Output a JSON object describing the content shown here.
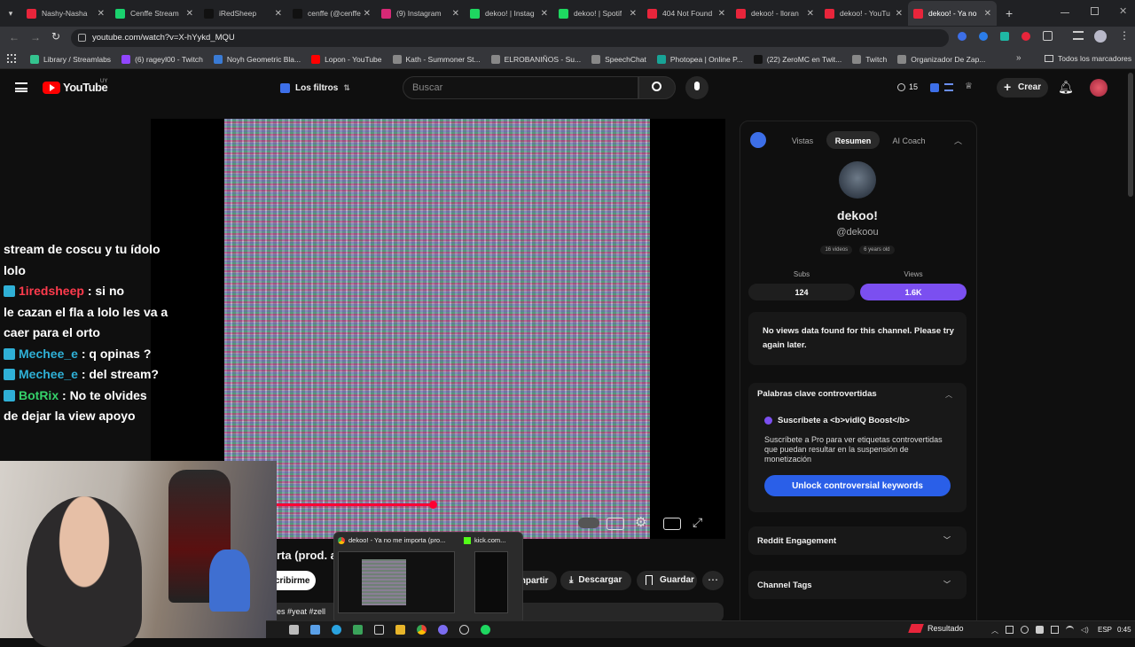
{
  "tabs": [
    {
      "label": "Nashy-Nasha",
      "color": "#e8253b"
    },
    {
      "label": "Cenffe Stream",
      "color": "#1ad16e"
    },
    {
      "label": "iRedSheep",
      "color": "#111111"
    },
    {
      "label": "cenffe (@cenffe",
      "color": "#111111"
    },
    {
      "label": "(9) Instagram",
      "color": "#d62976"
    },
    {
      "label": "dekoo! | Instag",
      "color": "#1ed760"
    },
    {
      "label": "dekoo! | Spotif",
      "color": "#1ed760"
    },
    {
      "label": "404 Not Found",
      "color": "#e8253b"
    },
    {
      "label": "dekoo! - lloran",
      "color": "#e8253b"
    },
    {
      "label": "dekoo! - YouTu",
      "color": "#e8253b"
    },
    {
      "label": "dekoo! - Ya no",
      "color": "#e8253b"
    }
  ],
  "url": "youtube.com/watch?v=X-hYykd_MQU",
  "bookmarks": [
    {
      "label": "Library / Streamlabs",
      "color": "#34c38f"
    },
    {
      "label": "(6) rageyl00 - Twitch",
      "color": "#9146ff"
    },
    {
      "label": "Noyh Geometric Bla...",
      "color": "#3a7bd5"
    },
    {
      "label": "Lopon - YouTube",
      "color": "#ff0000"
    },
    {
      "label": "Kath - Summoner St...",
      "color": "#888888"
    },
    {
      "label": "ELROBANIÑOS - Su...",
      "color": "#888888"
    },
    {
      "label": "SpeechChat",
      "color": "#888888"
    },
    {
      "label": "Photopea | Online P...",
      "color": "#18a497"
    },
    {
      "label": "(22) ZeroMC en Twit...",
      "color": "#111111"
    },
    {
      "label": "Twitch",
      "color": "#888888"
    },
    {
      "label": "Organizador De Zap...",
      "color": "#888888"
    }
  ],
  "bookmarks_all": "Todos los marcadores",
  "yt": {
    "logo": "YouTube",
    "region": "UY",
    "filters": "Los filtros",
    "search_placeholder": "Buscar",
    "notif_count": "15",
    "create": "Crear"
  },
  "chat": [
    {
      "user": "",
      "text": "stream de coscu y tu ídolo"
    },
    {
      "user": "",
      "text": "lolo"
    },
    {
      "user": "1iredsheep",
      "text": ": si no"
    },
    {
      "user": "",
      "text": "le cazan el fla a lolo les va a"
    },
    {
      "user": "",
      "text": "caer para el orto"
    },
    {
      "user": "Mechee_e",
      "text": ": q opinas ?"
    },
    {
      "user": "Mechee_e",
      "text": ": del stream?"
    },
    {
      "user": "BotRix",
      "text": ": No te olvides"
    },
    {
      "user": "",
      "text": "de dejar la view apoyo"
    }
  ],
  "video": {
    "progress": 0.49,
    "title_fragment": "rta (prod. a",
    "subscribe": "cribirme",
    "share": "mpartir",
    "download": "Descargar",
    "save": "Guardar",
    "tags": "es #yeat #zell"
  },
  "panel": {
    "tabs": [
      "Vistas",
      "Resumen",
      "AI Coach"
    ],
    "channel_name": "dekoo!",
    "handle": "@dekoou",
    "videos": "16 videos",
    "age": "6 years old",
    "subs_label": "Subs",
    "subs_value": "124",
    "views_label": "Views",
    "views_value": "1.6K",
    "no_data": "No views data found for this channel. Please try again later.",
    "kw_title": "Palabras clave controvertidas",
    "kw_boost": "Suscríbete a <b>vidIQ Boost</b>",
    "kw_desc": "Suscríbete a Pro para ver etiquetas controvertidas que puedan resultar en la suspensión de monetización",
    "kw_button": "Unlock controversial keywords",
    "reddit": "Reddit Engagement",
    "channel_tags": "Channel Tags"
  },
  "popup": {
    "item1": "dekoo! - Ya no me importa (pro...",
    "item2": "kick.com..."
  },
  "taskbar": {
    "resultado": "Resultado",
    "lang": "ESP",
    "time": "0:45"
  }
}
